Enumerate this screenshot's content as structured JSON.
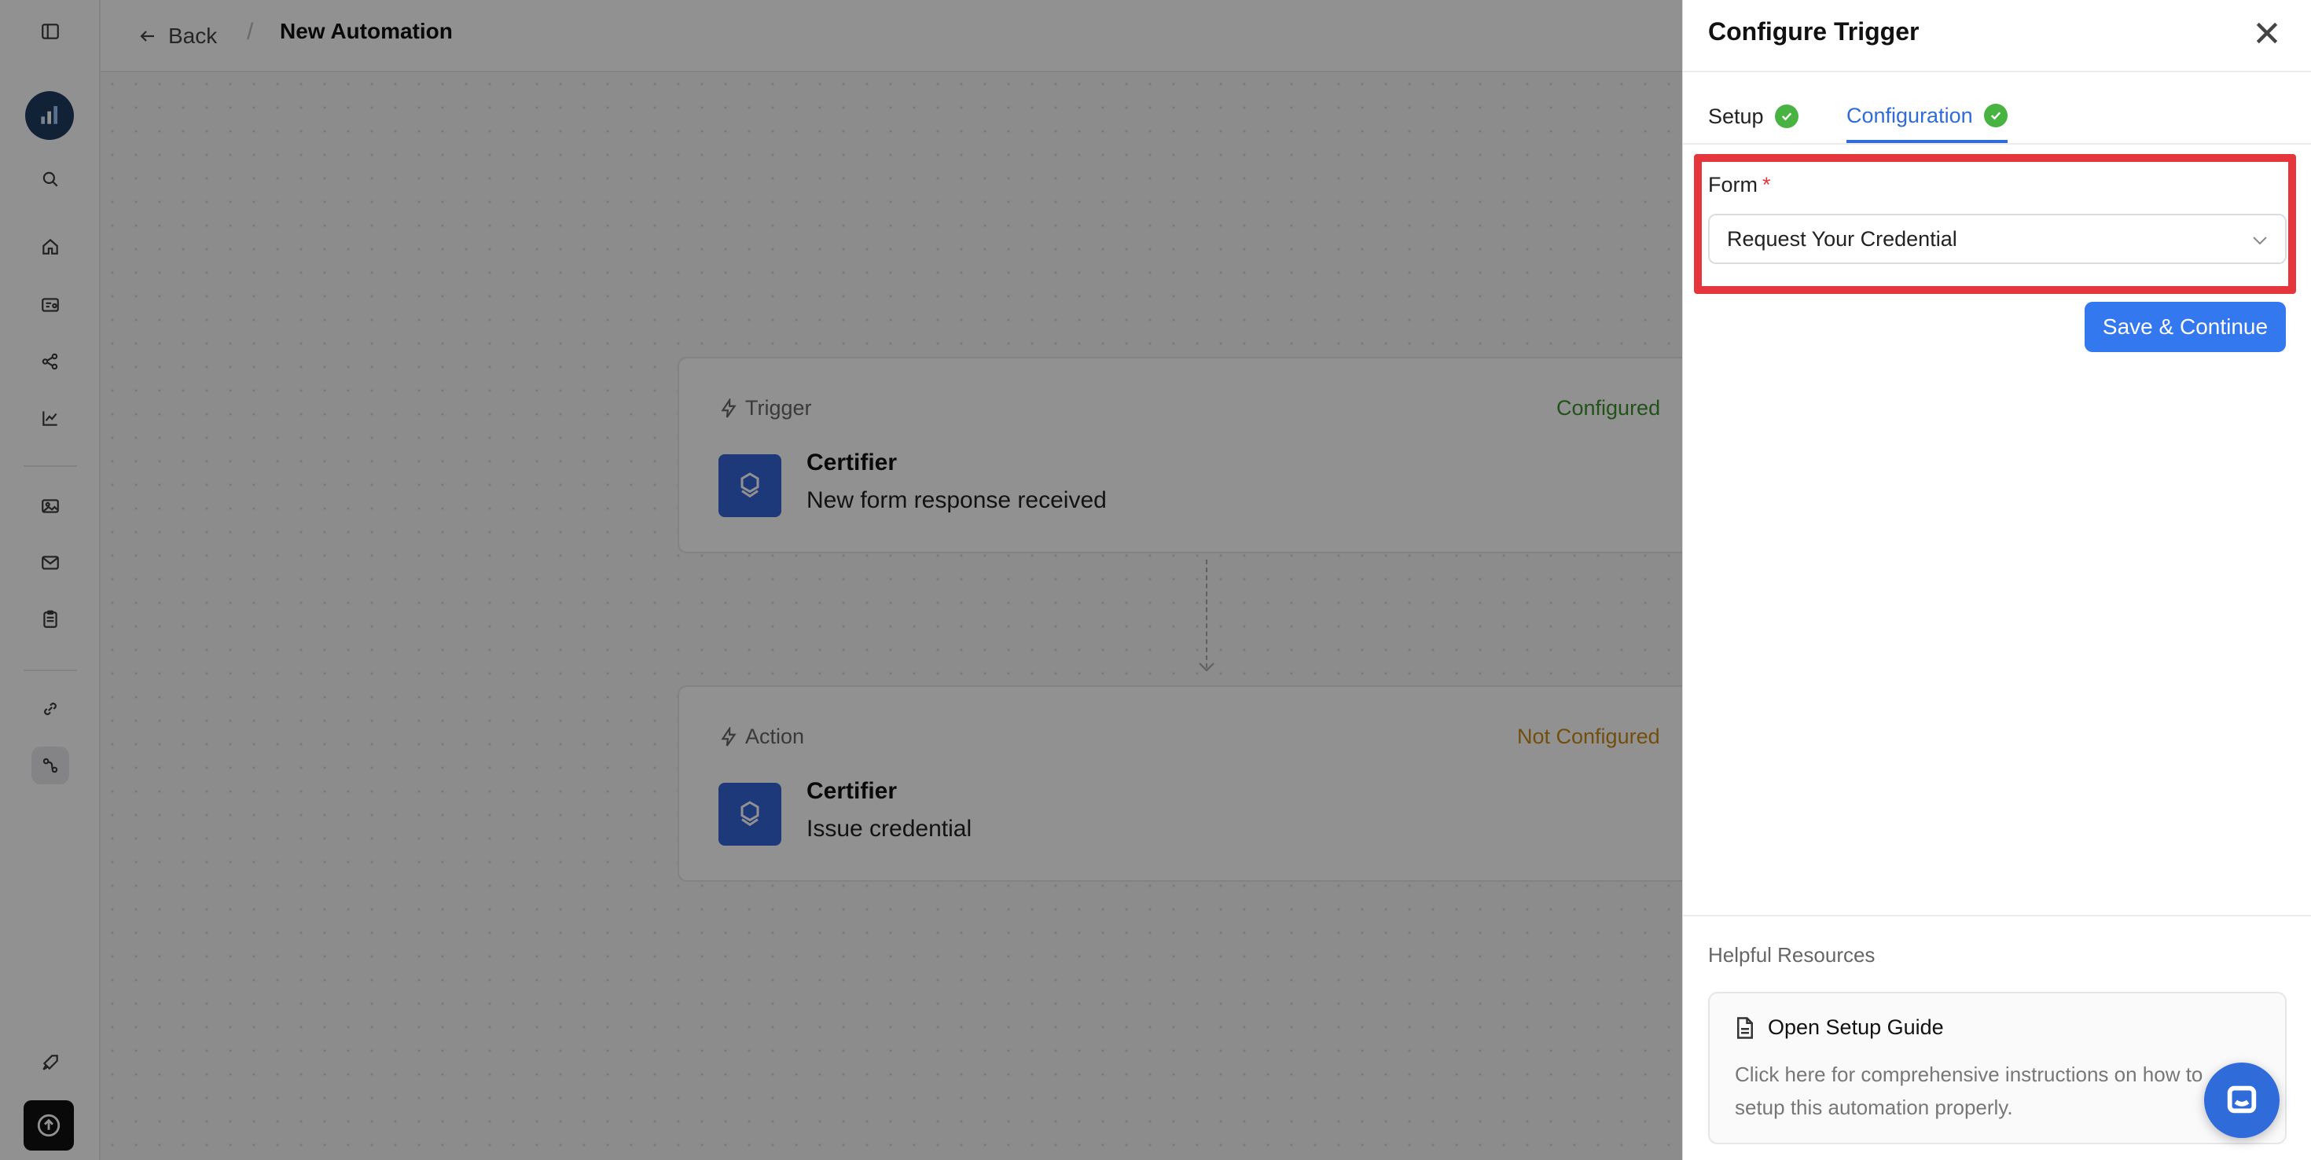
{
  "header": {
    "back_label": "Back",
    "separator": "/",
    "title": "New Automation"
  },
  "sidebar": {
    "items": [
      {
        "icon": "sidebar-toggle-icon"
      },
      {
        "icon": "analytics-logo"
      },
      {
        "icon": "search-icon"
      },
      {
        "icon": "home-icon"
      },
      {
        "icon": "credential-card-icon"
      },
      {
        "icon": "workflow-icon"
      },
      {
        "icon": "chart-line-icon"
      },
      {
        "icon": "image-icon"
      },
      {
        "icon": "mail-icon"
      },
      {
        "icon": "clipboard-icon"
      },
      {
        "icon": "link-icon"
      },
      {
        "icon": "automation-icon"
      },
      {
        "icon": "rocket-icon"
      },
      {
        "icon": "upload-icon"
      }
    ]
  },
  "canvas": {
    "trigger": {
      "label": "Trigger",
      "status": "Configured",
      "app": "Certifier",
      "event": "New form response received"
    },
    "action": {
      "label": "Action",
      "status": "Not Configured",
      "app": "Certifier",
      "event": "Issue credential"
    }
  },
  "panel": {
    "title": "Configure Trigger",
    "tabs": [
      {
        "label": "Setup",
        "complete": true
      },
      {
        "label": "Configuration",
        "complete": true,
        "active": true
      }
    ],
    "form": {
      "label": "Form",
      "required_mark": "*",
      "value": "Request Your Credential"
    },
    "save_label": "Save & Continue",
    "resources": {
      "title": "Helpful Resources",
      "guide_title": "Open Setup Guide",
      "guide_desc": "Click here for comprehensive instructions on how to setup this automation properly."
    }
  },
  "colors": {
    "accent": "#2f6bd9",
    "button": "#3478f0",
    "success": "#49b342",
    "configured_text": "#3f8f2f",
    "warning_text": "#c98a1a",
    "highlight": "#e5353d",
    "app_tile": "#3565d6"
  }
}
